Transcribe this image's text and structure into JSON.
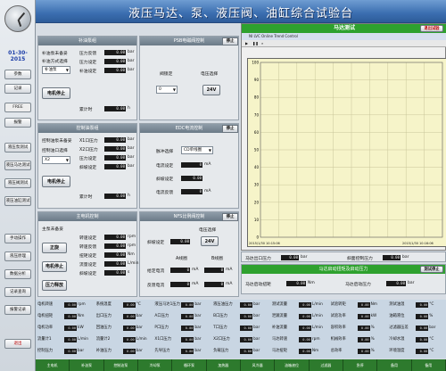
{
  "header": {
    "title": "液压马达、泵、液压阀、油缸综合试验台"
  },
  "sidebar": {
    "date": "01-30-2015",
    "status_label": "FREE",
    "buttons": [
      "参数",
      "记录",
      "报警",
      "液压泵测试",
      "液压马达测试",
      "液压阀测试",
      "液压油缸测试",
      "手动操作",
      "液压原理",
      "数据分析",
      "记录查询",
      "报警记录",
      "退出"
    ]
  },
  "p1": {
    "title": "补油泵组",
    "stop": "停止",
    "status": "补油泵未备妥",
    "mode_label": "补油方式选择",
    "mode": "补油泵",
    "r1": "压力反馈",
    "r2": "压力设定",
    "r3": "补油设定",
    "u": "bar",
    "run": "电机停止",
    "timer": "累计时",
    "timer_val": "0.00",
    "timer_unit": "h",
    "v1": "0.00",
    "v2": "0.00",
    "v3": "0.00"
  },
  "p2": {
    "title": "PSB电磁阀控制",
    "stop": "停止",
    "sel_label": "阀锁定",
    "sel_val": "0",
    "volt_label": "电压选择",
    "volt": "24V"
  },
  "p3": {
    "title": "控制油泵组",
    "stop": "停止",
    "status": "控制油泵未备妥",
    "mode_label": "控制油口选择",
    "mode": "X2",
    "r1": "X1口压力",
    "r2": "X2口压力",
    "r3": "压力设定",
    "r4": "斜坡设定",
    "u": "bar",
    "run": "电机停止",
    "timer": "累计时",
    "timer_val": "0.00",
    "timer_unit": "h"
  },
  "p4": {
    "title": "EDC电流控制",
    "stop": "停止",
    "r0": "脉冲选择",
    "mode": "CD单线圈",
    "r1": "电流设定",
    "r2": "斜坡设定",
    "r3": "电流反馈",
    "u": "mA",
    "v1": "0",
    "v2": "0.00",
    "v3": "0"
  },
  "p5": {
    "title": "主电机控制",
    "status": "主泵未备妥",
    "btn1": "正旋",
    "btn2": "电机停止",
    "btn3": "压力释放",
    "r1": "转速设定",
    "r2": "转速反馈",
    "r3": "扭矩设定",
    "r4": "流量设定",
    "r5": "斜坡设定",
    "u1": "rpm",
    "u2": "Nm",
    "u3": "L/min",
    "u4": "s"
  },
  "p6": {
    "title": "NFS比例阀控制",
    "stop": "停止",
    "volt_label": "电压选择",
    "volt": "24V",
    "r1": "斜坡设定",
    "r2": "给定电流",
    "r3": "反馈电流",
    "a": "A线圈",
    "b": "B线圈",
    "u": "mA"
  },
  "chart": {
    "head": "马达测试",
    "exit": "退出试验",
    "toolbar": "NI LVC Online Trend Control",
    "start_time": "2015/1/30 10:15:06",
    "end_time": "2015/1/30 10:16:06",
    "yticks": [
      "100",
      "90",
      "80",
      "70",
      "60",
      "50",
      "40",
      "30",
      "20",
      "10",
      "0"
    ],
    "xticks": [
      "0",
      "1",
      "2",
      "3",
      "4",
      "5",
      "6",
      "7",
      "8",
      "9",
      "10"
    ]
  },
  "pressure": {
    "t1": "马达出口压力",
    "t1v": "0.00",
    "t1u": "bar",
    "t2": "斜面控制压力",
    "t2v": "0.00",
    "t2u": "bar",
    "title": "马达启动扭矩及启动压力",
    "stop": "测试停止",
    "t3": "马达启动扭矩",
    "t3v": "0.00",
    "t3u": "Nm",
    "t4": "马达启动压力",
    "t4v": "0.00",
    "t4u": "bar"
  },
  "bottom": {
    "rows": [
      [
        "电机转速",
        "rpm",
        "系统温度",
        "°C",
        "液压马达1压力",
        "bar",
        "液压油压力",
        "bar",
        "测试流量",
        "L/min",
        "试验转矩",
        "Nm",
        "测试油温",
        "°C"
      ],
      [
        "电机扭矩",
        "Nm",
        "出口压力",
        "bar",
        "A口压力",
        "bar",
        "B口压力",
        "bar",
        "泄漏流量",
        "L/min",
        "试验功率",
        "kW",
        "油箱液位",
        "%"
      ],
      [
        "电机功率",
        "kW",
        "回油压力",
        "bar",
        "P口压力",
        "bar",
        "T口压力",
        "bar",
        "补油流量",
        "L/min",
        "容积效率",
        "%",
        "过滤器压差",
        "bar"
      ],
      [
        "流量计1",
        "L/min",
        "流量计2",
        "L/min",
        "X1口压力",
        "bar",
        "X2口压力",
        "bar",
        "马达转速",
        "rpm",
        "机械效率",
        "%",
        "冷却水温",
        "°C"
      ],
      [
        "控制压力",
        "bar",
        "补油压力",
        "bar",
        "先导压力",
        "bar",
        "负载压力",
        "bar",
        "马达扭矩",
        "Nm",
        "总效率",
        "%",
        "环境温度",
        "°C"
      ]
    ],
    "vals": "0.00",
    "legend": [
      "正常",
      "报警",
      "故障"
    ],
    "footer": [
      "主电机",
      "补油泵",
      "控制油泵",
      "冷却泵",
      "循环泵",
      "加热器",
      "风冷器",
      "油箱液位",
      "过滤器",
      "急停",
      "备用",
      "备用"
    ]
  },
  "colors": {
    "accent": "#3b6eb0",
    "green": "#2ea12e"
  }
}
